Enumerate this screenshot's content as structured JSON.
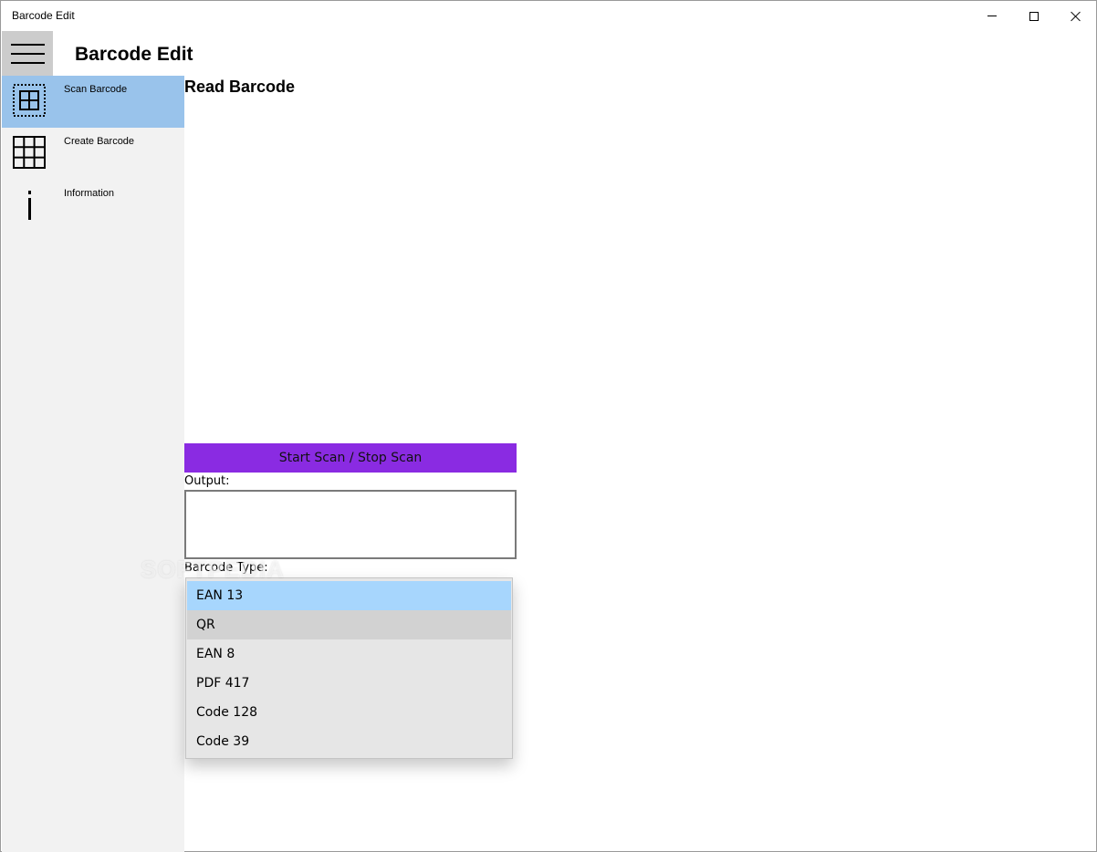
{
  "window": {
    "title": "Barcode Edit",
    "controls": {
      "minimize_icon": "minimize-icon",
      "maximize_icon": "maximize-icon",
      "close_icon": "close-icon"
    }
  },
  "app": {
    "title": "Barcode Edit",
    "menu_icon": "hamburger-menu-icon"
  },
  "sidebar": {
    "items": [
      {
        "label": "Scan Barcode",
        "icon": "scan-barcode-icon",
        "selected": true
      },
      {
        "label": "Create Barcode",
        "icon": "grid-icon",
        "selected": false
      },
      {
        "label": "Information",
        "icon": "info-icon",
        "selected": false
      }
    ]
  },
  "main": {
    "heading": "Read Barcode",
    "scan_button_label": "Start Scan / Stop Scan",
    "output_label": "Output:",
    "output_value": "",
    "barcode_type_label": "Barcode Type:",
    "barcode_type_options": [
      "EAN 13",
      "QR",
      "EAN 8",
      "PDF 417",
      "Code 128",
      "Code 39"
    ],
    "selected_option": "EAN 13",
    "hovered_option": "QR"
  },
  "watermark": "SOFTPEDIA",
  "colors": {
    "accent_button": "#8a2be2",
    "sidebar_selected": "#99c3eb",
    "sidebar_bg": "#f2f2f2",
    "dropdown_selected": "#a7d6fd",
    "dropdown_hover": "#d2d2d2",
    "hamburger_bg": "#cccccc"
  }
}
